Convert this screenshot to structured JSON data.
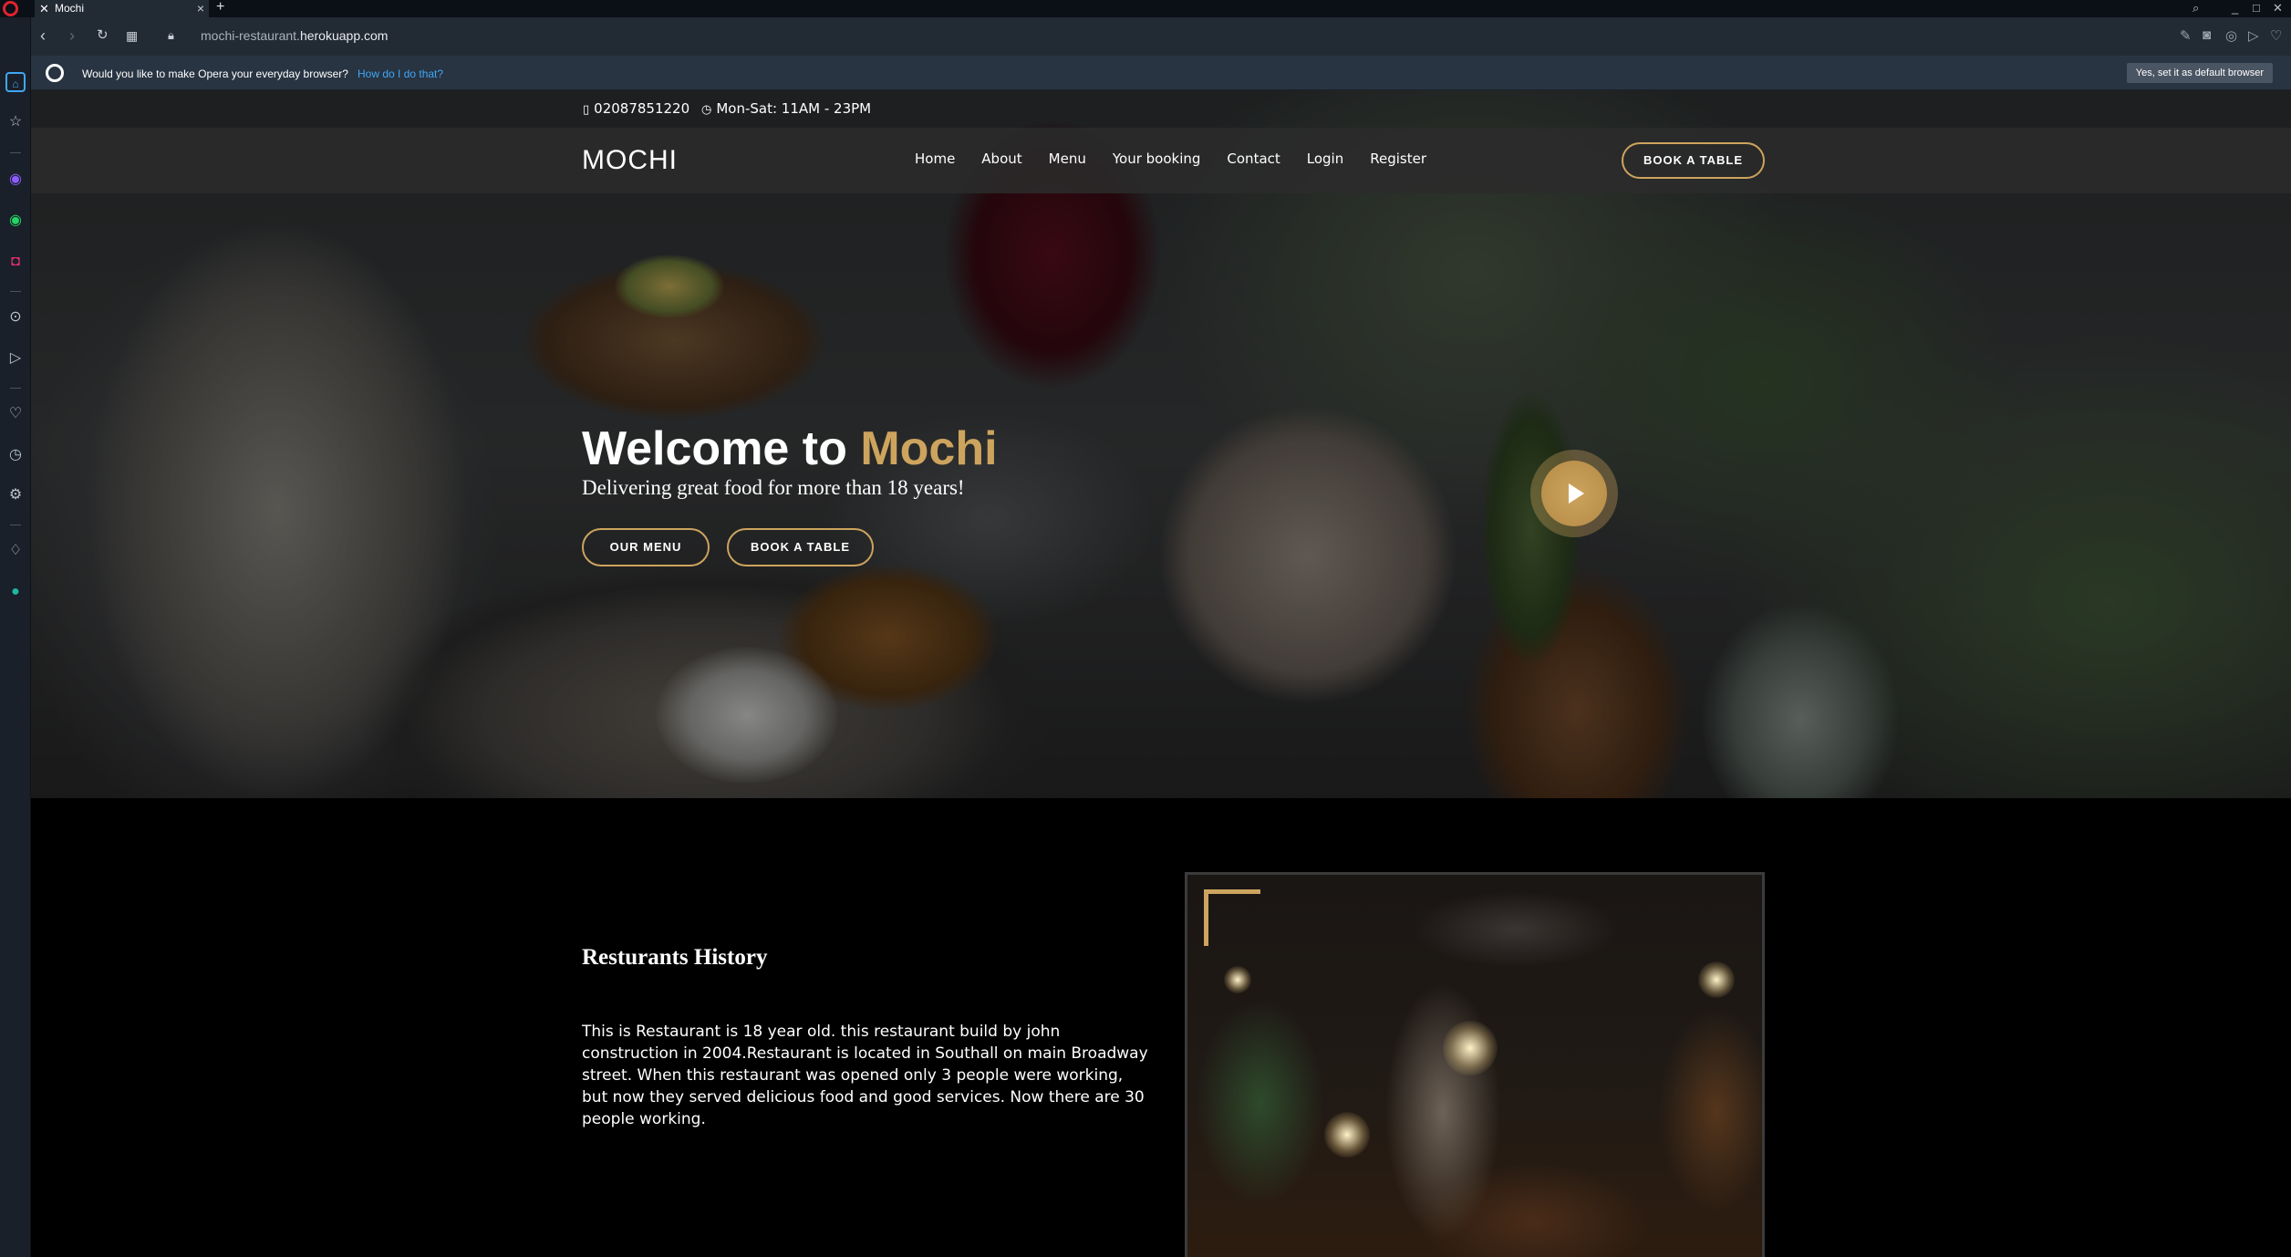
{
  "browser": {
    "tab_title": "Mochi",
    "tab_favicon": "fork-knife-icon",
    "new_tab": "+",
    "tab_close": "×",
    "url_prefix": "mochi-restaurant.",
    "url_domain": "herokuapp.com",
    "infobar_text": "Would you like to make Opera your everyday browser?",
    "infobar_link": "How do I do that?",
    "infobar_button": "Yes, set it as default browser"
  },
  "site": {
    "phone": "02087851220",
    "hours": "Mon-Sat: 11AM - 23PM",
    "logo": "MOCHI",
    "menu": [
      "Home",
      "About",
      "Menu",
      "Your booking",
      "Contact",
      "Login",
      "Register"
    ],
    "nav_book": "BOOK A TABLE",
    "hero": {
      "title_prefix": "Welcome to ",
      "title_accent": "Mochi",
      "subtitle": "Delivering great food for more than 18 years!",
      "btn_menu": "OUR MENU",
      "btn_book": "BOOK A TABLE"
    },
    "about": {
      "title": "Resturants History",
      "text": "This is Restaurant is 18 year old. this restaurant build by john construction in 2004.Restaurant is located in Southall on main Broadway street. When this restaurant was opened only 3 people were working, but now they served delicious food and good services. Now there are 30 people working."
    },
    "accent_color": "#cda45e"
  }
}
